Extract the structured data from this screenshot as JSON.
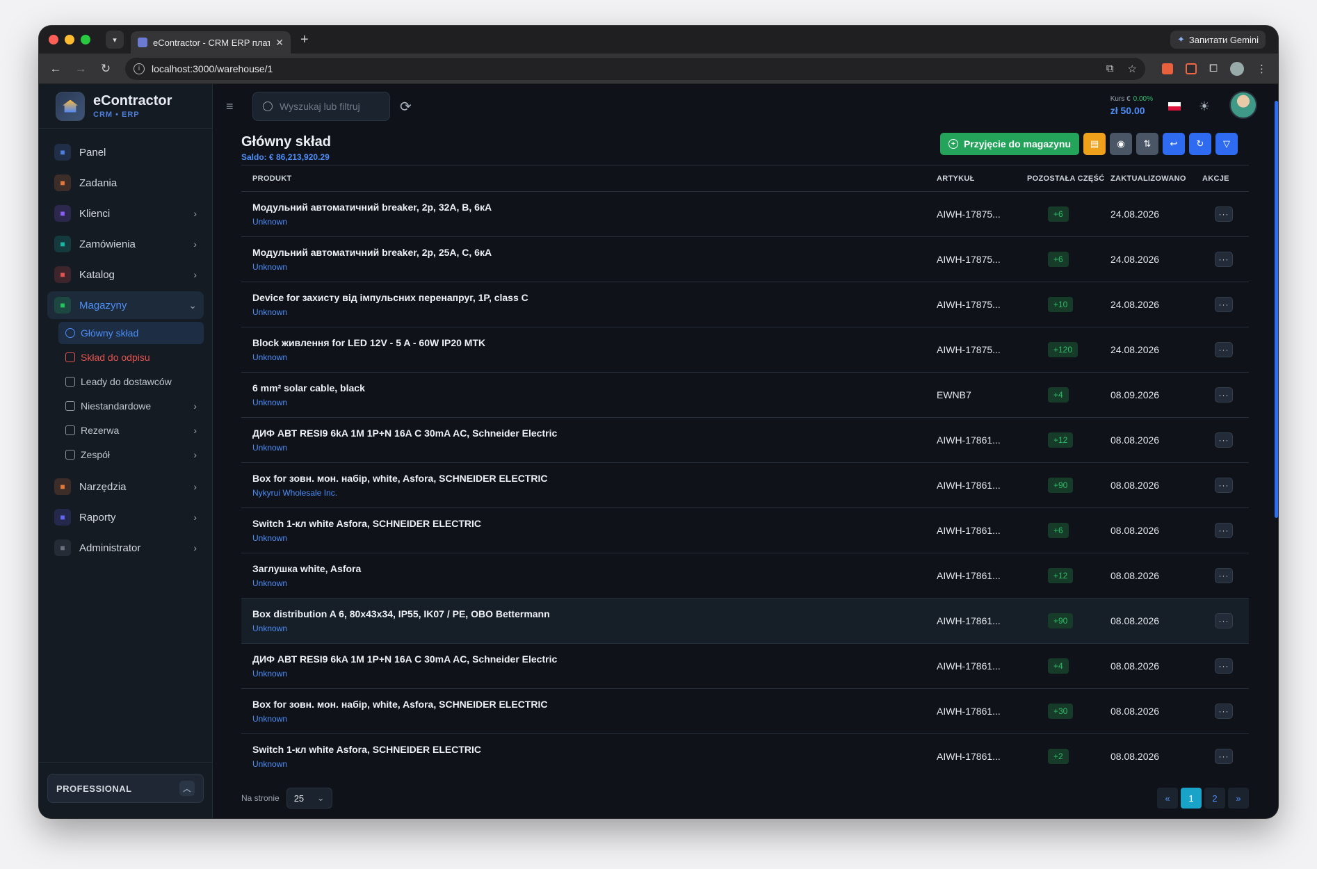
{
  "browser": {
    "tab_title": "eContractor - CRM ERP плат",
    "gemini_label": "Запитати Gemini",
    "url": "localhost:3000/warehouse/1"
  },
  "brand": {
    "name": "eContractor",
    "sub": "CRM • ERP"
  },
  "sidebar": {
    "items": [
      {
        "label": "Panel",
        "icon": "chart-icon",
        "color": "#4f7fdc",
        "chevron": false
      },
      {
        "label": "Zadania",
        "icon": "clipboard-icon",
        "color": "#e2783c",
        "chevron": false
      },
      {
        "label": "Klienci",
        "icon": "users-icon",
        "color": "#8b5cf6",
        "chevron": true
      },
      {
        "label": "Zamówienia",
        "icon": "gear-icon",
        "color": "#14b8a6",
        "chevron": true
      },
      {
        "label": "Katalog",
        "icon": "box-icon",
        "color": "#e4524f",
        "chevron": true
      },
      {
        "label": "Magazyny",
        "icon": "warehouse-icon",
        "color": "#22c55e",
        "chevron": true
      }
    ],
    "sub_items": [
      {
        "label": "Główny skład",
        "state": "active",
        "chevron": false
      },
      {
        "label": "Skład do odpisu",
        "state": "red",
        "chevron": false
      },
      {
        "label": "Leady do dostawców",
        "state": "",
        "chevron": false
      },
      {
        "label": "Niestandardowe",
        "state": "",
        "chevron": true
      },
      {
        "label": "Rezerwa",
        "state": "",
        "chevron": true
      },
      {
        "label": "Zespół",
        "state": "",
        "chevron": true
      }
    ],
    "bottom_items": [
      {
        "label": "Narzędzia",
        "icon": "toolbox-icon",
        "color": "#e2783c"
      },
      {
        "label": "Raporty",
        "icon": "report-icon",
        "color": "#6366f1"
      },
      {
        "label": "Administrator",
        "icon": "admin-gear-icon",
        "color": "#6b7280"
      }
    ],
    "plan": "PROFESSIONAL"
  },
  "topbar": {
    "search_placeholder": "Wyszukaj lub filtruj",
    "rate_label": "Kurs €",
    "rate_change": "0.00%",
    "rate_value": "zł 50.00"
  },
  "page": {
    "title": "Główny skład",
    "saldo": "Saldo: € 86,213,920.29",
    "add_button": "Przyjęcie do magazynu"
  },
  "table": {
    "headers": [
      "PRODUKT",
      "ARTYKUŁ",
      "POZOSTAŁA CZĘŚĆ",
      "ZAKTUALIZOWANO",
      "AKCJE"
    ],
    "rows": [
      {
        "name": "Модульний автоматичний breaker, 2p, 32A, B, 6кА",
        "supplier": "Unknown",
        "article": "AIWH-17875...",
        "remaining": "+6",
        "updated": "24.08.2026"
      },
      {
        "name": "Модульний автоматичний breaker, 2p, 25A, C, 6кА",
        "supplier": "Unknown",
        "article": "AIWH-17875...",
        "remaining": "+6",
        "updated": "24.08.2026"
      },
      {
        "name": "Device for захисту від імпульсних перенапруг, 1P, class C",
        "supplier": "Unknown",
        "article": "AIWH-17875...",
        "remaining": "+10",
        "updated": "24.08.2026"
      },
      {
        "name": "Block живлення for LED 12V - 5 A - 60W IP20 MTK",
        "supplier": "Unknown",
        "article": "AIWH-17875...",
        "remaining": "+120",
        "updated": "24.08.2026"
      },
      {
        "name": "6 mm² solar cable, black",
        "supplier": "Unknown",
        "article": "EWNB7",
        "remaining": "+4",
        "updated": "08.09.2026"
      },
      {
        "name": "ДИФ АВТ RESI9 6kA 1M 1P+N 16A C 30mA AC, Schneider Electric",
        "supplier": "Unknown",
        "article": "AIWH-17861...",
        "remaining": "+12",
        "updated": "08.08.2026"
      },
      {
        "name": "Box for зовн. мон. набір, white, Asfora, SCHNEIDER ELECTRIC",
        "supplier": "Nykyrui Wholesale Inc.",
        "article": "AIWH-17861...",
        "remaining": "+90",
        "updated": "08.08.2026"
      },
      {
        "name": "Switch 1-кл white Asfora, SCHNEIDER ELECTRIC",
        "supplier": "Unknown",
        "article": "AIWH-17861...",
        "remaining": "+6",
        "updated": "08.08.2026"
      },
      {
        "name": "Заглушка white, Asfora",
        "supplier": "Unknown",
        "article": "AIWH-17861...",
        "remaining": "+12",
        "updated": "08.08.2026"
      },
      {
        "name": "Box distribution A 6, 80x43x34, IP55, IK07 / PE, OBO Bettermann",
        "supplier": "Unknown",
        "article": "AIWH-17861...",
        "remaining": "+90",
        "updated": "08.08.2026"
      },
      {
        "name": "ДИФ АВТ RESI9 6kA 1M 1P+N 16A C 30mA AC, Schneider Electric",
        "supplier": "Unknown",
        "article": "AIWH-17861...",
        "remaining": "+4",
        "updated": "08.08.2026"
      },
      {
        "name": "Box for зовн. мон. набір, white, Asfora, SCHNEIDER ELECTRIC",
        "supplier": "Unknown",
        "article": "AIWH-17861...",
        "remaining": "+30",
        "updated": "08.08.2026"
      },
      {
        "name": "Switch 1-кл white Asfora, SCHNEIDER ELECTRIC",
        "supplier": "Unknown",
        "article": "AIWH-17861...",
        "remaining": "+2",
        "updated": "08.08.2026"
      }
    ]
  },
  "footer": {
    "per_page_label": "Na stronie",
    "per_page_value": "25",
    "pages": [
      "«",
      "1",
      "2",
      "»"
    ],
    "current_page": "1"
  }
}
